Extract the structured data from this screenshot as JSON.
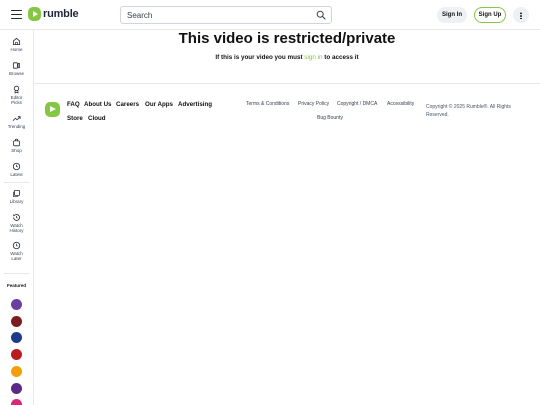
{
  "header": {
    "logo_text": "rumble",
    "search_placeholder": "Search",
    "signin_label": "Sign In",
    "signup_label": "Sign Up"
  },
  "sidebar": {
    "items": [
      {
        "label": "Home",
        "icon": "home-icon"
      },
      {
        "label": "Browse",
        "icon": "browse-icon"
      },
      {
        "label": "Editor Picks",
        "icon": "award-icon"
      },
      {
        "label": "Trending",
        "icon": "trending-icon"
      },
      {
        "label": "Shop",
        "icon": "shop-icon"
      },
      {
        "label": "Latest",
        "icon": "clock-icon"
      },
      {
        "label": "Library",
        "icon": "library-icon"
      },
      {
        "label": "Watch History",
        "icon": "history-icon"
      },
      {
        "label": "Watch Later",
        "icon": "watch-later-icon"
      }
    ],
    "featured_title": "Featured",
    "featured_channels": [
      {
        "icon": "channel-avatar-1",
        "color": "#6b3fa0"
      },
      {
        "icon": "channel-avatar-2",
        "color": "#7a1d1d"
      },
      {
        "icon": "channel-avatar-3",
        "color": "#1e3a8a"
      },
      {
        "icon": "channel-avatar-4",
        "color": "#b91c1c"
      },
      {
        "icon": "channel-avatar-5",
        "color": "#f59e0b"
      },
      {
        "icon": "channel-avatar-6",
        "color": "#5b2a86"
      },
      {
        "icon": "channel-avatar-7",
        "color": "#db2777"
      }
    ]
  },
  "main": {
    "title": "This video is restricted/private",
    "subtitle_pre": "If this is your video you must",
    "subtitle_link": "sign in",
    "subtitle_post": "to access it"
  },
  "footer": {
    "links": [
      "FAQ",
      "About Us",
      "Careers",
      "Our Apps",
      "Advertising",
      "Store",
      "Cloud"
    ],
    "secondary_links": [
      "Terms & Conditions",
      "Privacy Policy",
      "Copyright / DMCA",
      "Accessibility",
      "Bug Bounty"
    ],
    "copyright": "Copyright © 2025 Rumble®. All Rights Reserved."
  },
  "colors": {
    "brand": "#85c742",
    "border": "#e5e7eb",
    "text": "#111111"
  }
}
